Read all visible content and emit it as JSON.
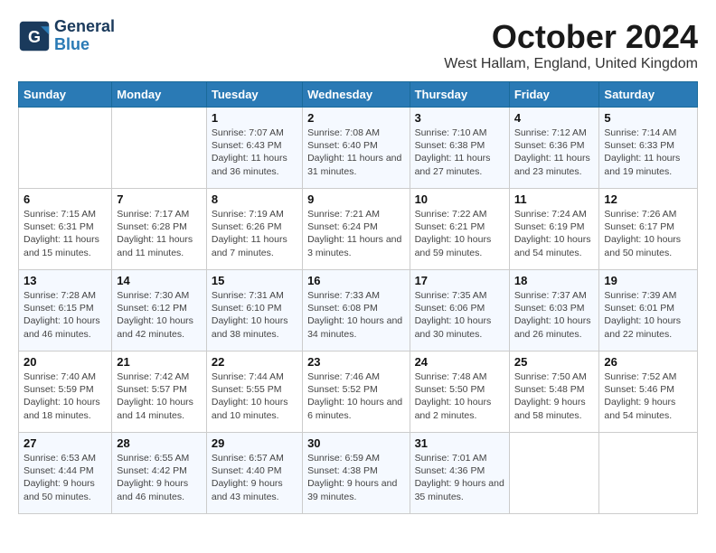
{
  "logo": {
    "line1": "General",
    "line2": "Blue"
  },
  "title": "October 2024",
  "location": "West Hallam, England, United Kingdom",
  "days_of_week": [
    "Sunday",
    "Monday",
    "Tuesday",
    "Wednesday",
    "Thursday",
    "Friday",
    "Saturday"
  ],
  "weeks": [
    [
      {
        "num": "",
        "info": ""
      },
      {
        "num": "",
        "info": ""
      },
      {
        "num": "1",
        "info": "Sunrise: 7:07 AM\nSunset: 6:43 PM\nDaylight: 11 hours and 36 minutes."
      },
      {
        "num": "2",
        "info": "Sunrise: 7:08 AM\nSunset: 6:40 PM\nDaylight: 11 hours and 31 minutes."
      },
      {
        "num": "3",
        "info": "Sunrise: 7:10 AM\nSunset: 6:38 PM\nDaylight: 11 hours and 27 minutes."
      },
      {
        "num": "4",
        "info": "Sunrise: 7:12 AM\nSunset: 6:36 PM\nDaylight: 11 hours and 23 minutes."
      },
      {
        "num": "5",
        "info": "Sunrise: 7:14 AM\nSunset: 6:33 PM\nDaylight: 11 hours and 19 minutes."
      }
    ],
    [
      {
        "num": "6",
        "info": "Sunrise: 7:15 AM\nSunset: 6:31 PM\nDaylight: 11 hours and 15 minutes."
      },
      {
        "num": "7",
        "info": "Sunrise: 7:17 AM\nSunset: 6:28 PM\nDaylight: 11 hours and 11 minutes."
      },
      {
        "num": "8",
        "info": "Sunrise: 7:19 AM\nSunset: 6:26 PM\nDaylight: 11 hours and 7 minutes."
      },
      {
        "num": "9",
        "info": "Sunrise: 7:21 AM\nSunset: 6:24 PM\nDaylight: 11 hours and 3 minutes."
      },
      {
        "num": "10",
        "info": "Sunrise: 7:22 AM\nSunset: 6:21 PM\nDaylight: 10 hours and 59 minutes."
      },
      {
        "num": "11",
        "info": "Sunrise: 7:24 AM\nSunset: 6:19 PM\nDaylight: 10 hours and 54 minutes."
      },
      {
        "num": "12",
        "info": "Sunrise: 7:26 AM\nSunset: 6:17 PM\nDaylight: 10 hours and 50 minutes."
      }
    ],
    [
      {
        "num": "13",
        "info": "Sunrise: 7:28 AM\nSunset: 6:15 PM\nDaylight: 10 hours and 46 minutes."
      },
      {
        "num": "14",
        "info": "Sunrise: 7:30 AM\nSunset: 6:12 PM\nDaylight: 10 hours and 42 minutes."
      },
      {
        "num": "15",
        "info": "Sunrise: 7:31 AM\nSunset: 6:10 PM\nDaylight: 10 hours and 38 minutes."
      },
      {
        "num": "16",
        "info": "Sunrise: 7:33 AM\nSunset: 6:08 PM\nDaylight: 10 hours and 34 minutes."
      },
      {
        "num": "17",
        "info": "Sunrise: 7:35 AM\nSunset: 6:06 PM\nDaylight: 10 hours and 30 minutes."
      },
      {
        "num": "18",
        "info": "Sunrise: 7:37 AM\nSunset: 6:03 PM\nDaylight: 10 hours and 26 minutes."
      },
      {
        "num": "19",
        "info": "Sunrise: 7:39 AM\nSunset: 6:01 PM\nDaylight: 10 hours and 22 minutes."
      }
    ],
    [
      {
        "num": "20",
        "info": "Sunrise: 7:40 AM\nSunset: 5:59 PM\nDaylight: 10 hours and 18 minutes."
      },
      {
        "num": "21",
        "info": "Sunrise: 7:42 AM\nSunset: 5:57 PM\nDaylight: 10 hours and 14 minutes."
      },
      {
        "num": "22",
        "info": "Sunrise: 7:44 AM\nSunset: 5:55 PM\nDaylight: 10 hours and 10 minutes."
      },
      {
        "num": "23",
        "info": "Sunrise: 7:46 AM\nSunset: 5:52 PM\nDaylight: 10 hours and 6 minutes."
      },
      {
        "num": "24",
        "info": "Sunrise: 7:48 AM\nSunset: 5:50 PM\nDaylight: 10 hours and 2 minutes."
      },
      {
        "num": "25",
        "info": "Sunrise: 7:50 AM\nSunset: 5:48 PM\nDaylight: 9 hours and 58 minutes."
      },
      {
        "num": "26",
        "info": "Sunrise: 7:52 AM\nSunset: 5:46 PM\nDaylight: 9 hours and 54 minutes."
      }
    ],
    [
      {
        "num": "27",
        "info": "Sunrise: 6:53 AM\nSunset: 4:44 PM\nDaylight: 9 hours and 50 minutes."
      },
      {
        "num": "28",
        "info": "Sunrise: 6:55 AM\nSunset: 4:42 PM\nDaylight: 9 hours and 46 minutes."
      },
      {
        "num": "29",
        "info": "Sunrise: 6:57 AM\nSunset: 4:40 PM\nDaylight: 9 hours and 43 minutes."
      },
      {
        "num": "30",
        "info": "Sunrise: 6:59 AM\nSunset: 4:38 PM\nDaylight: 9 hours and 39 minutes."
      },
      {
        "num": "31",
        "info": "Sunrise: 7:01 AM\nSunset: 4:36 PM\nDaylight: 9 hours and 35 minutes."
      },
      {
        "num": "",
        "info": ""
      },
      {
        "num": "",
        "info": ""
      }
    ]
  ]
}
